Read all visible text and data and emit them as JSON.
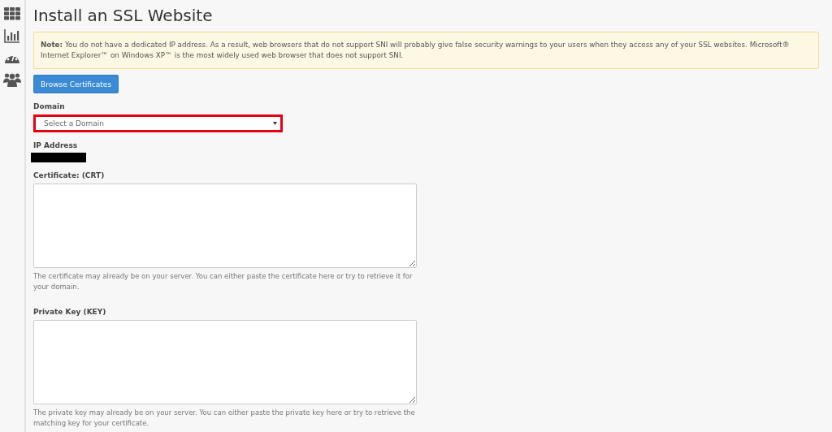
{
  "sidebar": {
    "items": [
      {
        "kind": "grid"
      },
      {
        "kind": "chart"
      },
      {
        "kind": "gauge"
      },
      {
        "kind": "users"
      }
    ]
  },
  "page": {
    "title": "Install an SSL Website"
  },
  "note": {
    "text": "**Note:** You do not have a dedicated IP address. As a result, web browsers that do not support SNI will probably give false security warnings to your users when they access any of your SSL websites. Microsoft® Internet Explorer™ on Windows XP™ is the most widely used web browser that does not support SNI."
  },
  "browse_button": {
    "label": "Browse Certificates"
  },
  "domain": {
    "label": "Domain",
    "placeholder": "Select a Domain",
    "highlighted": true
  },
  "ip_address": {
    "label": "IP Address",
    "redacted": true
  },
  "certificate": {
    "label": "Certificate: (CRT)",
    "help": "The certificate may already be on your server. You can either paste the certificate here or try to retrieve it for your domain."
  },
  "private_key": {
    "label": "Private Key (KEY)",
    "help": "The private key may already be on your server. You can either paste the private key here or try to retrieve the matching key for your certificate."
  }
}
